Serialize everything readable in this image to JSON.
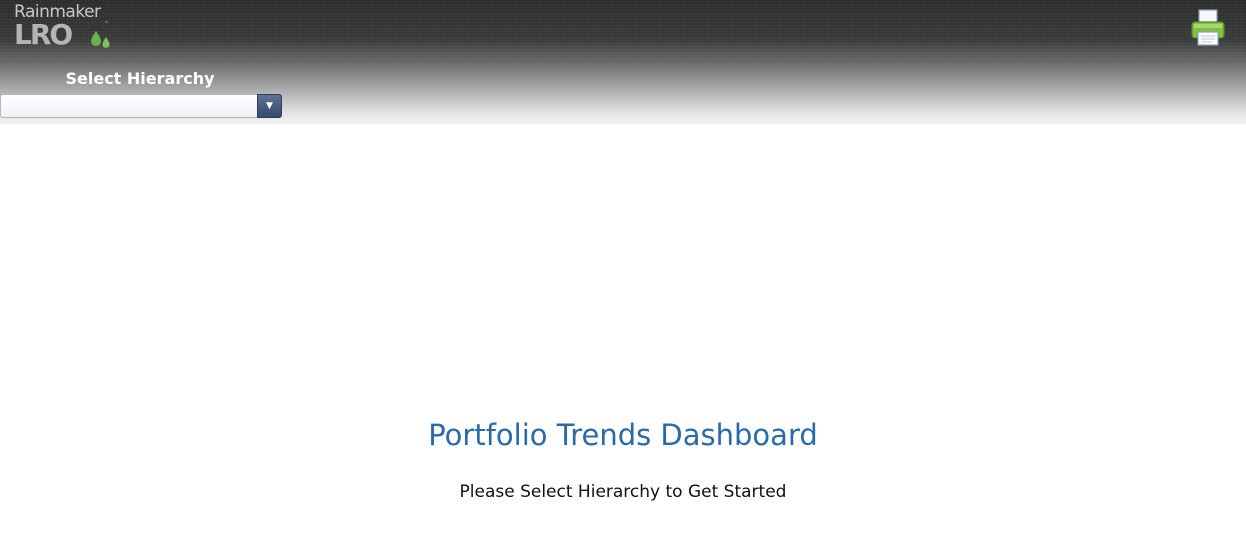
{
  "header": {
    "logo": {
      "line1": "Rainmaker",
      "line2": "LRO",
      "trademark": "™",
      "drop_color": "#6ab04c"
    },
    "print_icon": "printer-icon",
    "hierarchy_label": "Select Hierarchy",
    "hierarchy_select": {
      "value": "",
      "arrow_glyph": "▼"
    }
  },
  "main": {
    "title": "Portfolio Trends Dashboard",
    "prompt": "Please Select Hierarchy to Get Started"
  },
  "colors": {
    "title": "#2b6aa8",
    "select_button": "#34496b"
  }
}
